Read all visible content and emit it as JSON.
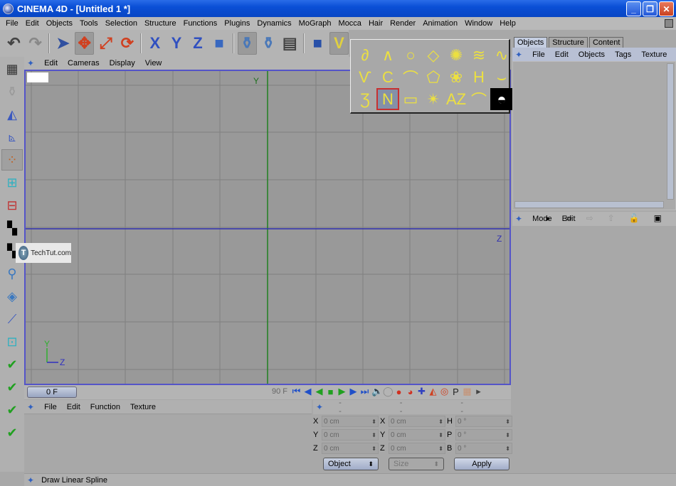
{
  "window": {
    "title": "CINEMA 4D - [Untitled 1 *]",
    "minimize": "_",
    "restore": "❐",
    "close": "✕"
  },
  "menubar": [
    "File",
    "Edit",
    "Objects",
    "Tools",
    "Selection",
    "Structure",
    "Functions",
    "Plugins",
    "Dynamics",
    "MoGraph",
    "Mocca",
    "Hair",
    "Render",
    "Animation",
    "Window",
    "Help"
  ],
  "toolbar": [
    {
      "name": "undo-icon",
      "glyph": "↶",
      "color": "#444"
    },
    {
      "name": "redo-icon",
      "glyph": "↷",
      "color": "#888"
    },
    {
      "name": "live-selection-icon",
      "glyph": "➤",
      "color": "#3050a0"
    },
    {
      "name": "move-icon",
      "glyph": "✥",
      "color": "#d04020",
      "selected": true
    },
    {
      "name": "scale-icon",
      "glyph": "⤢",
      "color": "#d04020"
    },
    {
      "name": "rotate-icon",
      "glyph": "⟳",
      "color": "#d04020"
    },
    {
      "name": "x-axis-icon",
      "glyph": "X",
      "color": "#3050c0"
    },
    {
      "name": "y-axis-icon",
      "glyph": "Y",
      "color": "#3050c0"
    },
    {
      "name": "z-axis-icon",
      "glyph": "Z",
      "color": "#3050c0"
    },
    {
      "name": "world-coords-icon",
      "glyph": "■",
      "color": "#3868c0"
    },
    {
      "name": "render-view-icon",
      "glyph": "⚱",
      "color": "#4a78b8",
      "selected": true
    },
    {
      "name": "render-picture-viewer-icon",
      "glyph": "⚱",
      "color": "#4a78b8"
    },
    {
      "name": "render-settings-icon",
      "glyph": "▤",
      "color": "#444"
    },
    {
      "name": "cube-icon",
      "glyph": "■",
      "color": "#2850a8"
    },
    {
      "name": "spline-pen-icon",
      "glyph": "V",
      "color": "#e0d040",
      "selected": true
    }
  ],
  "viewport": {
    "menu": [
      "Edit",
      "Cameras",
      "Display",
      "View"
    ],
    "axis_y": "Y",
    "axis_z": "Z",
    "mini_axis_y": "Y",
    "mini_axis_z": "Z"
  },
  "watermark": {
    "logo": "T",
    "text": "TechTut.com"
  },
  "spline_palette": [
    {
      "name": "freehand-spline",
      "glyph": "∂"
    },
    {
      "name": "bezier-spline",
      "glyph": "∧"
    },
    {
      "name": "circle-spline",
      "glyph": "○"
    },
    {
      "name": "nside-spline",
      "glyph": "◇"
    },
    {
      "name": "cogwheel-spline",
      "glyph": "✺"
    },
    {
      "name": "helix-spline",
      "glyph": "≋"
    },
    {
      "name": "formula-spline",
      "glyph": "∿"
    },
    {
      "name": "bspline-spline",
      "glyph": "Ѵ"
    },
    {
      "name": "akima-spline",
      "glyph": "C"
    },
    {
      "name": "arc-spline",
      "glyph": "⌒"
    },
    {
      "name": "polygon-spline",
      "glyph": "⬠"
    },
    {
      "name": "flower-spline",
      "glyph": "❀"
    },
    {
      "name": "profile-spline",
      "glyph": "H"
    },
    {
      "name": "cissoid-spline",
      "glyph": "⌣"
    },
    {
      "name": "cubic-spline",
      "glyph": "Ʒ"
    },
    {
      "name": "linear-spline",
      "glyph": "N",
      "selected": true
    },
    {
      "name": "rectangle-spline",
      "glyph": "▭"
    },
    {
      "name": "star-spline",
      "glyph": "✴"
    },
    {
      "name": "text-spline",
      "glyph": "AZ"
    },
    {
      "name": "4side-spline",
      "glyph": "⌒"
    },
    {
      "name": "contour-spline",
      "glyph": "◓"
    }
  ],
  "sidebar": [
    {
      "name": "layout-icon",
      "glyph": "▦"
    },
    {
      "name": "model-mode-icon",
      "glyph": "⚱"
    },
    {
      "name": "object-axis-mode-icon",
      "glyph": "◭"
    },
    {
      "name": "axis-mode-icon",
      "glyph": "⦝"
    },
    {
      "name": "points-mode-icon",
      "glyph": "⁘",
      "selected": true
    },
    {
      "name": "edges-mode-icon",
      "glyph": "⊞"
    },
    {
      "name": "polygons-mode-icon",
      "glyph": "⊟"
    },
    {
      "name": "texture-mode-icon",
      "glyph": "▚"
    },
    {
      "name": "texture-axis-mode-icon",
      "glyph": "▚"
    },
    {
      "name": "animation-mode-icon",
      "glyph": "⚲"
    },
    {
      "name": "workplane-icon",
      "glyph": "◈"
    },
    {
      "name": "joint-mode-icon",
      "glyph": "⟋"
    },
    {
      "name": "tweak-mode-icon",
      "glyph": "⊡"
    },
    {
      "name": "enable-snap-icon",
      "glyph": "✔"
    },
    {
      "name": "enable-axis-icon",
      "glyph": "✔"
    },
    {
      "name": "enable-render-icon",
      "glyph": "✔"
    },
    {
      "name": "enable-particles-icon",
      "glyph": "✔"
    }
  ],
  "timeline": {
    "current_frame": "0 F",
    "end_frame": "90 F"
  },
  "playback": [
    {
      "name": "goto-start-icon",
      "glyph": "⏮",
      "color": "#2050c8"
    },
    {
      "name": "prev-key-icon",
      "glyph": "◀",
      "color": "#2050c8"
    },
    {
      "name": "play-reverse-icon",
      "glyph": "◀",
      "color": "#20a020"
    },
    {
      "name": "stop-icon",
      "glyph": "■",
      "color": "#20a020"
    },
    {
      "name": "play-icon",
      "glyph": "▶",
      "color": "#20a020"
    },
    {
      "name": "next-key-icon",
      "glyph": "▶",
      "color": "#2050c8"
    },
    {
      "name": "goto-end-icon",
      "glyph": "⏭",
      "color": "#2050c8"
    },
    {
      "name": "sound-icon",
      "glyph": "🔈",
      "color": "#444"
    },
    {
      "name": "record-icon",
      "glyph": "◯",
      "color": "#888"
    },
    {
      "name": "autokey-icon",
      "glyph": "●",
      "color": "#d03020"
    },
    {
      "name": "keyframe-selection-icon",
      "glyph": "◕",
      "color": "#d03020"
    },
    {
      "name": "position-key-icon",
      "glyph": "✚",
      "color": "#3040c0"
    },
    {
      "name": "scale-key-icon",
      "glyph": "◭",
      "color": "#d04020"
    },
    {
      "name": "rotation-key-icon",
      "glyph": "◎",
      "color": "#d04020"
    },
    {
      "name": "parameter-key-icon",
      "glyph": "P",
      "color": "#222"
    },
    {
      "name": "point-level-key-icon",
      "glyph": "▦",
      "color": "#c89070"
    },
    {
      "name": "timeline-options-icon",
      "glyph": "▸",
      "color": "#444"
    }
  ],
  "material_manager": {
    "menu": [
      "File",
      "Edit",
      "Function",
      "Texture"
    ]
  },
  "coordinates": {
    "header": [
      "--",
      "--",
      "--"
    ],
    "rows": [
      {
        "pos_label": "X",
        "pos": "0 cm",
        "size_label": "X",
        "size": "0 cm",
        "rot_label": "H",
        "rot": "0 °"
      },
      {
        "pos_label": "Y",
        "pos": "0 cm",
        "size_label": "Y",
        "size": "0 cm",
        "rot_label": "P",
        "rot": "0 °"
      },
      {
        "pos_label": "Z",
        "pos": "0 cm",
        "size_label": "Z",
        "size": "0 cm",
        "rot_label": "B",
        "rot": "0 °"
      }
    ],
    "mode_select": "Object",
    "size_select": "Size",
    "apply": "Apply"
  },
  "object_manager": {
    "tabs": [
      "Objects",
      "Structure",
      "Content"
    ],
    "active_tab": 0,
    "menu": [
      "File",
      "Edit",
      "Objects",
      "Tags",
      "Texture"
    ]
  },
  "attribute_manager": {
    "menu": [
      "Mode",
      "Edit"
    ]
  },
  "statusbar": {
    "text": "Draw Linear Spline"
  }
}
